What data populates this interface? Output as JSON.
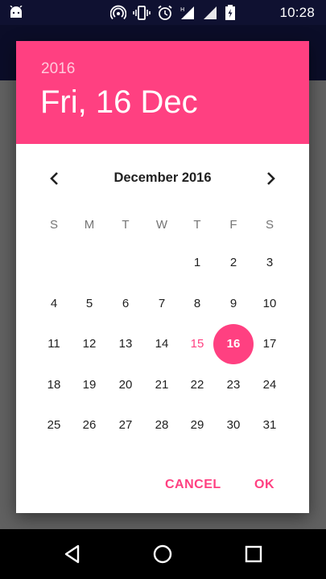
{
  "status_bar": {
    "time": "10:28",
    "icons": [
      "android-icon",
      "hotspot-icon",
      "vibrate-icon",
      "alarm-icon",
      "signal-icon",
      "wifi-icon",
      "battery-icon"
    ]
  },
  "colors": {
    "accent": "#ff4081",
    "status_bar": "#0f1131",
    "app_bar": "#1a1e5a"
  },
  "dialog": {
    "year": "2016",
    "selected_date": "Fri, 16 Dec",
    "month_label": "December 2016",
    "prev_icon": "chevron-left-icon",
    "next_icon": "chevron-right-icon",
    "weekdays": [
      "S",
      "M",
      "T",
      "W",
      "T",
      "F",
      "S"
    ],
    "weeks": [
      [
        "",
        "",
        "",
        "",
        "1",
        "2",
        "3"
      ],
      [
        "4",
        "5",
        "6",
        "7",
        "8",
        "9",
        "10"
      ],
      [
        "11",
        "12",
        "13",
        "14",
        "15",
        "16",
        "17"
      ],
      [
        "18",
        "19",
        "20",
        "21",
        "22",
        "23",
        "24"
      ],
      [
        "25",
        "26",
        "27",
        "28",
        "29",
        "30",
        "31"
      ]
    ],
    "today": "15",
    "selected_day": "16",
    "cancel_label": "CANCEL",
    "ok_label": "OK"
  },
  "nav_bar": {
    "icons": [
      "back-icon",
      "home-icon",
      "recents-icon"
    ]
  }
}
